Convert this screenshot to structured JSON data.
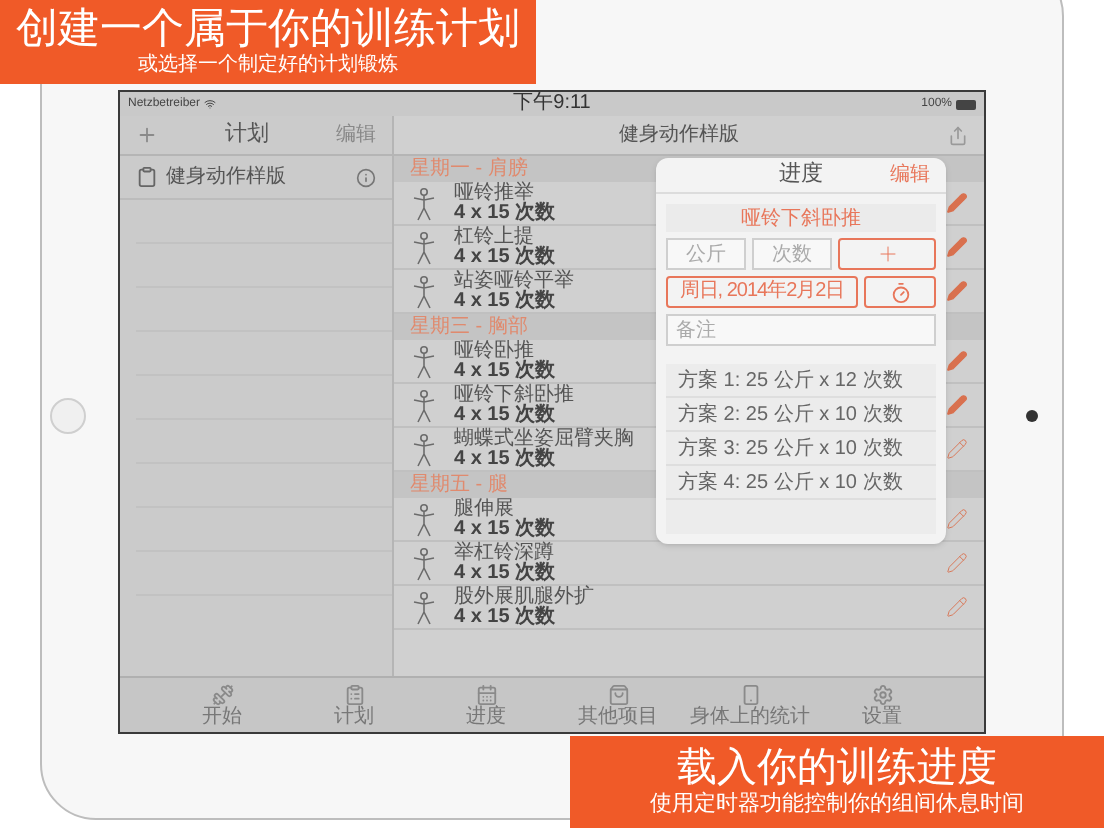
{
  "promo_top": {
    "title": "创建一个属于你的训练计划",
    "subtitle": "或选择一个制定好的计划锻炼"
  },
  "status_bar": {
    "carrier": "Netzbetreiber",
    "time": "下午9:11",
    "battery": "100%"
  },
  "sidebar": {
    "title": "计划",
    "edit": "编辑",
    "items": [
      {
        "label": "健身动作样版"
      }
    ]
  },
  "main": {
    "title": "健身动作样版",
    "sections": [
      {
        "title": "星期一 - 肩膀",
        "exercises": [
          {
            "name": "哑铃推举",
            "sets": "4 x 15 次数",
            "logged": true
          },
          {
            "name": "杠铃上提",
            "sets": "4 x 15 次数",
            "logged": true
          },
          {
            "name": "站姿哑铃平举",
            "sets": "4 x 15 次数",
            "logged": true
          }
        ]
      },
      {
        "title": "星期三 - 胸部",
        "exercises": [
          {
            "name": "哑铃卧推",
            "sets": "4 x 15 次数",
            "logged": true
          },
          {
            "name": "哑铃下斜卧推",
            "sets": "4 x 15 次数",
            "logged": true
          },
          {
            "name": "蝴蝶式坐姿屈臂夹胸",
            "sets": "4 x 15 次数",
            "logged": false
          }
        ]
      },
      {
        "title": "星期五 - 腿",
        "exercises": [
          {
            "name": "腿伸展",
            "sets": "4 x 15 次数",
            "logged": false
          },
          {
            "name": "举杠铃深蹲",
            "sets": "4 x 15 次数",
            "logged": false
          },
          {
            "name": "股外展肌腿外扩",
            "sets": "4 x 15 次数",
            "logged": false
          }
        ]
      }
    ]
  },
  "popover": {
    "title": "进度",
    "edit": "编辑",
    "exercise": "哑铃下斜卧推",
    "weight_placeholder": "公斤",
    "reps_placeholder": "次数",
    "date": "周日, 2014年2月2日",
    "note_placeholder": "备注",
    "sets": [
      "方案 1: 25 公斤 x 12 次数",
      "方案 2: 25 公斤 x 10 次数",
      "方案 3: 25 公斤 x 10 次数",
      "方案 4: 25 公斤 x 10 次数"
    ]
  },
  "tab_bar": [
    {
      "label": "开始"
    },
    {
      "label": "计划"
    },
    {
      "label": "进度"
    },
    {
      "label": "其他项目"
    },
    {
      "label": "身体上的统计"
    },
    {
      "label": "设置"
    }
  ],
  "promo_bottom": {
    "title": "载入你的训练进度",
    "subtitle": "使用定时器功能控制你的组间休息时间"
  }
}
